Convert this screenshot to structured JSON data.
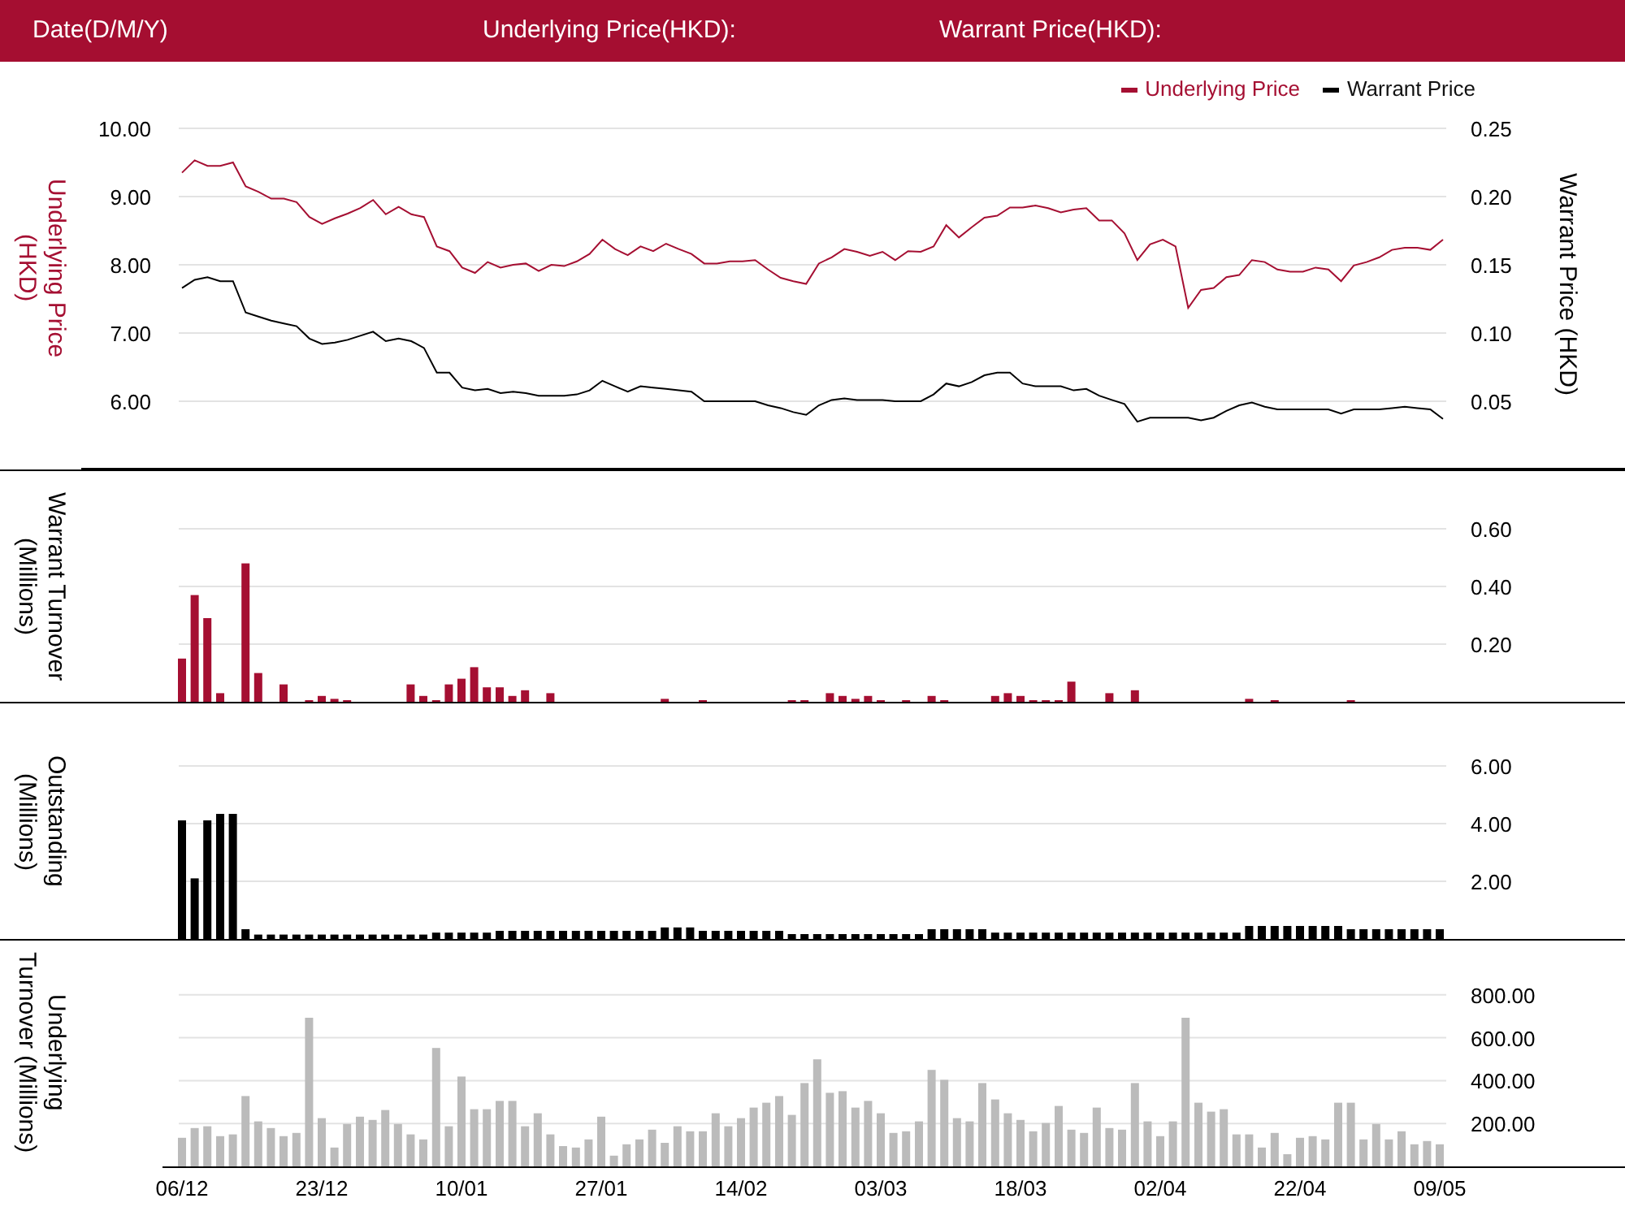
{
  "header": {
    "date_label": "Date(D/M/Y)",
    "underlying_price_label": "Underlying Price(HKD):",
    "warrant_price_label": "Warrant Price(HKD):"
  },
  "price_chart": {
    "chart_data": {
      "type": "line",
      "ylabel": "Underlying Price (HKD)",
      "y2label": "Warrant Price (HKD)",
      "grid": true,
      "ylim": [
        5,
        10
      ],
      "y2lim": [
        0,
        0.25
      ],
      "yticks": [
        {
          "value": 10,
          "label": "10.00"
        },
        {
          "value": 9,
          "label": "9.00"
        },
        {
          "value": 8,
          "label": "8.00"
        },
        {
          "value": 7,
          "label": "7.00"
        },
        {
          "value": 6,
          "label": "6.00"
        }
      ],
      "y2ticks": [
        {
          "value": 0.25,
          "label": "0.25"
        },
        {
          "value": 0.2,
          "label": "0.20"
        },
        {
          "value": 0.15,
          "label": "0.15"
        },
        {
          "value": 0.1,
          "label": "0.10"
        },
        {
          "value": 0.05,
          "label": "0.05"
        }
      ],
      "series": [
        {
          "name": "Underlying Price",
          "color": "#a50f32",
          "values": [
            9.35,
            9.53,
            9.45,
            9.45,
            9.5,
            9.15,
            9.07,
            8.97,
            8.97,
            8.92,
            8.7,
            8.6,
            8.68,
            8.75,
            8.83,
            8.95,
            8.74,
            8.85,
            8.74,
            8.7,
            8.27,
            8.2,
            7.96,
            7.88,
            8.04,
            7.96,
            8,
            8.02,
            7.91,
            8,
            7.98,
            8.05,
            8.16,
            8.37,
            8.23,
            8.14,
            8.27,
            8.2,
            8.31,
            8.23,
            8.16,
            8.02,
            8.02,
            8.05,
            8.05,
            8.07,
            7.93,
            7.81,
            7.76,
            7.72,
            8.02,
            8.11,
            8.23,
            8.19,
            8.13,
            8.19,
            8.07,
            8.2,
            8.19,
            8.27,
            8.58,
            8.4,
            8.55,
            8.69,
            8.72,
            8.84,
            8.84,
            8.87,
            8.83,
            8.77,
            8.81,
            8.83,
            8.65,
            8.65,
            8.46,
            8.07,
            8.3,
            8.37,
            8.27,
            7.37,
            7.63,
            7.66,
            7.82,
            7.85,
            8.07,
            8.04,
            7.93,
            7.9,
            7.9,
            7.96,
            7.93,
            7.76,
            7.99,
            8.04,
            8.11,
            8.22,
            8.25,
            8.25,
            8.22,
            8.37
          ]
        },
        {
          "name": "Warrant Price",
          "color": "#000000",
          "axis": "y2",
          "values": [
            0.133,
            0.139,
            0.141,
            0.138,
            0.138,
            0.115,
            0.112,
            0.109,
            0.107,
            0.105,
            0.096,
            0.092,
            0.093,
            0.095,
            0.098,
            0.101,
            0.094,
            0.096,
            0.094,
            0.089,
            0.071,
            0.071,
            0.06,
            0.058,
            0.059,
            0.056,
            0.057,
            0.056,
            0.054,
            0.054,
            0.054,
            0.055,
            0.058,
            0.065,
            0.061,
            0.057,
            0.061,
            0.06,
            0.059,
            0.058,
            0.057,
            0.05,
            0.05,
            0.05,
            0.05,
            0.05,
            0.047,
            0.045,
            0.042,
            0.04,
            0.047,
            0.051,
            0.052,
            0.051,
            0.051,
            0.051,
            0.05,
            0.05,
            0.05,
            0.055,
            0.063,
            0.061,
            0.064,
            0.069,
            0.071,
            0.071,
            0.063,
            0.061,
            0.061,
            0.061,
            0.058,
            0.059,
            0.054,
            0.051,
            0.048,
            0.035,
            0.038,
            0.038,
            0.038,
            0.038,
            0.036,
            0.038,
            0.043,
            0.047,
            0.049,
            0.046,
            0.044,
            0.044,
            0.044,
            0.044,
            0.044,
            0.041,
            0.044,
            0.044,
            0.044,
            0.045,
            0.046,
            0.045,
            0.044,
            0.037
          ]
        }
      ]
    }
  },
  "warrant_turnover_chart": {
    "chart_data": {
      "type": "bar",
      "grid": true,
      "ylabel": "Warrant Turnover (Millions)",
      "ylim": [
        0,
        0.6
      ],
      "yticks": [
        {
          "value": 0.6,
          "label": "0.60"
        },
        {
          "value": 0.4,
          "label": "0.40"
        },
        {
          "value": 0.2,
          "label": "0.20"
        }
      ],
      "series": [
        {
          "color": "#a50f32",
          "values": [
            0.15,
            0.37,
            0.29,
            0.03,
            0,
            0.48,
            0.1,
            0,
            0.06,
            0,
            0.005,
            0.02,
            0.01,
            0.005,
            0,
            0,
            0,
            0,
            0.06,
            0.02,
            0.005,
            0.06,
            0.08,
            0.12,
            0.05,
            0.05,
            0.02,
            0.04,
            0,
            0.03,
            0,
            0,
            0,
            0,
            0,
            0,
            0,
            0,
            0.01,
            0,
            0,
            0.005,
            0,
            0,
            0,
            0,
            0,
            0,
            0.005,
            0.005,
            0,
            0.03,
            0.02,
            0.01,
            0.02,
            0.005,
            0,
            0.005,
            0,
            0.02,
            0.005,
            0,
            0,
            0,
            0.02,
            0.03,
            0.02,
            0.005,
            0.005,
            0.005,
            0.07,
            0,
            0,
            0.03,
            0,
            0.04,
            0,
            0,
            0,
            0,
            0,
            0,
            0,
            0,
            0.01,
            0,
            0.005,
            0,
            0,
            0,
            0,
            0,
            0.005,
            0,
            0,
            0,
            0,
            0,
            0,
            0
          ]
        }
      ]
    }
  },
  "outstanding_chart": {
    "chart_data": {
      "type": "bar",
      "grid": true,
      "ylabel": "Outstanding (Millions)",
      "ylim": [
        0,
        6
      ],
      "yticks": [
        {
          "value": 6,
          "label": "6.00"
        },
        {
          "value": 4,
          "label": "4.00"
        },
        {
          "value": 2,
          "label": "2.00"
        }
      ],
      "series": [
        {
          "color": "#000000",
          "values": [
            4.11,
            2.1,
            4.11,
            4.34,
            4.34,
            0.34,
            0.15,
            0.15,
            0.15,
            0.15,
            0.15,
            0.15,
            0.15,
            0.15,
            0.15,
            0.15,
            0.15,
            0.15,
            0.15,
            0.15,
            0.22,
            0.22,
            0.22,
            0.22,
            0.22,
            0.28,
            0.28,
            0.28,
            0.28,
            0.28,
            0.28,
            0.28,
            0.28,
            0.28,
            0.28,
            0.28,
            0.28,
            0.28,
            0.4,
            0.4,
            0.4,
            0.28,
            0.28,
            0.28,
            0.28,
            0.28,
            0.28,
            0.28,
            0.17,
            0.17,
            0.17,
            0.17,
            0.17,
            0.17,
            0.17,
            0.17,
            0.17,
            0.17,
            0.17,
            0.34,
            0.34,
            0.34,
            0.34,
            0.34,
            0.22,
            0.22,
            0.22,
            0.22,
            0.22,
            0.22,
            0.22,
            0.22,
            0.22,
            0.22,
            0.22,
            0.22,
            0.22,
            0.22,
            0.22,
            0.22,
            0.22,
            0.22,
            0.22,
            0.22,
            0.45,
            0.45,
            0.45,
            0.45,
            0.45,
            0.45,
            0.45,
            0.45,
            0.34,
            0.34,
            0.34,
            0.34,
            0.34,
            0.34,
            0.34,
            0.34
          ]
        }
      ]
    }
  },
  "underlying_turnover_chart": {
    "chart_data": {
      "type": "bar",
      "grid": true,
      "ylabel": "Underlying Turnover (Millions)",
      "ylim": [
        0,
        800
      ],
      "yticks": [
        {
          "value": 800,
          "label": "800.00"
        },
        {
          "value": 600,
          "label": "600.00"
        },
        {
          "value": 400,
          "label": "400.00"
        },
        {
          "value": 200,
          "label": "200.00"
        }
      ],
      "categories": [
        "06/12",
        null,
        null,
        null,
        null,
        null,
        null,
        null,
        null,
        null,
        null,
        "23/12",
        null,
        null,
        null,
        null,
        null,
        null,
        null,
        null,
        null,
        null,
        "10/01",
        null,
        null,
        null,
        null,
        null,
        null,
        null,
        null,
        null,
        null,
        "27/01",
        null,
        null,
        null,
        null,
        null,
        null,
        null,
        null,
        null,
        null,
        "14/02",
        null,
        null,
        null,
        null,
        null,
        null,
        null,
        null,
        null,
        null,
        "03/03",
        null,
        null,
        null,
        null,
        null,
        null,
        null,
        null,
        null,
        null,
        "18/03",
        null,
        null,
        null,
        null,
        null,
        null,
        null,
        null,
        null,
        null,
        "02/04",
        null,
        null,
        null,
        null,
        null,
        null,
        null,
        null,
        null,
        null,
        "22/04",
        null,
        null,
        null,
        null,
        null,
        null,
        null,
        null,
        null,
        null,
        "09/05"
      ],
      "series": [
        {
          "color": "#bbbbbb",
          "values": [
            133,
            179,
            187,
            141,
            149,
            328,
            210,
            179,
            141,
            156,
            693,
            225,
            88,
            198,
            232,
            217,
            263,
            198,
            149,
            126,
            552,
            187,
            419,
            267,
            267,
            305,
            305,
            187,
            248,
            149,
            95,
            88,
            126,
            232,
            50,
            103,
            126,
            171,
            110,
            187,
            164,
            164,
            248,
            187,
            225,
            274,
            297,
            328,
            240,
            389,
            499,
            343,
            351,
            274,
            305,
            248,
            156,
            164,
            210,
            450,
            404,
            225,
            210,
            389,
            312,
            248,
            217,
            164,
            202,
            282,
            171,
            156,
            274,
            179,
            171,
            389,
            210,
            141,
            210,
            693,
            297,
            255,
            267,
            149,
            149,
            88,
            156,
            57,
            133,
            141,
            126,
            297,
            297,
            126,
            198,
            126,
            164,
            103,
            118,
            103
          ]
        }
      ]
    }
  }
}
